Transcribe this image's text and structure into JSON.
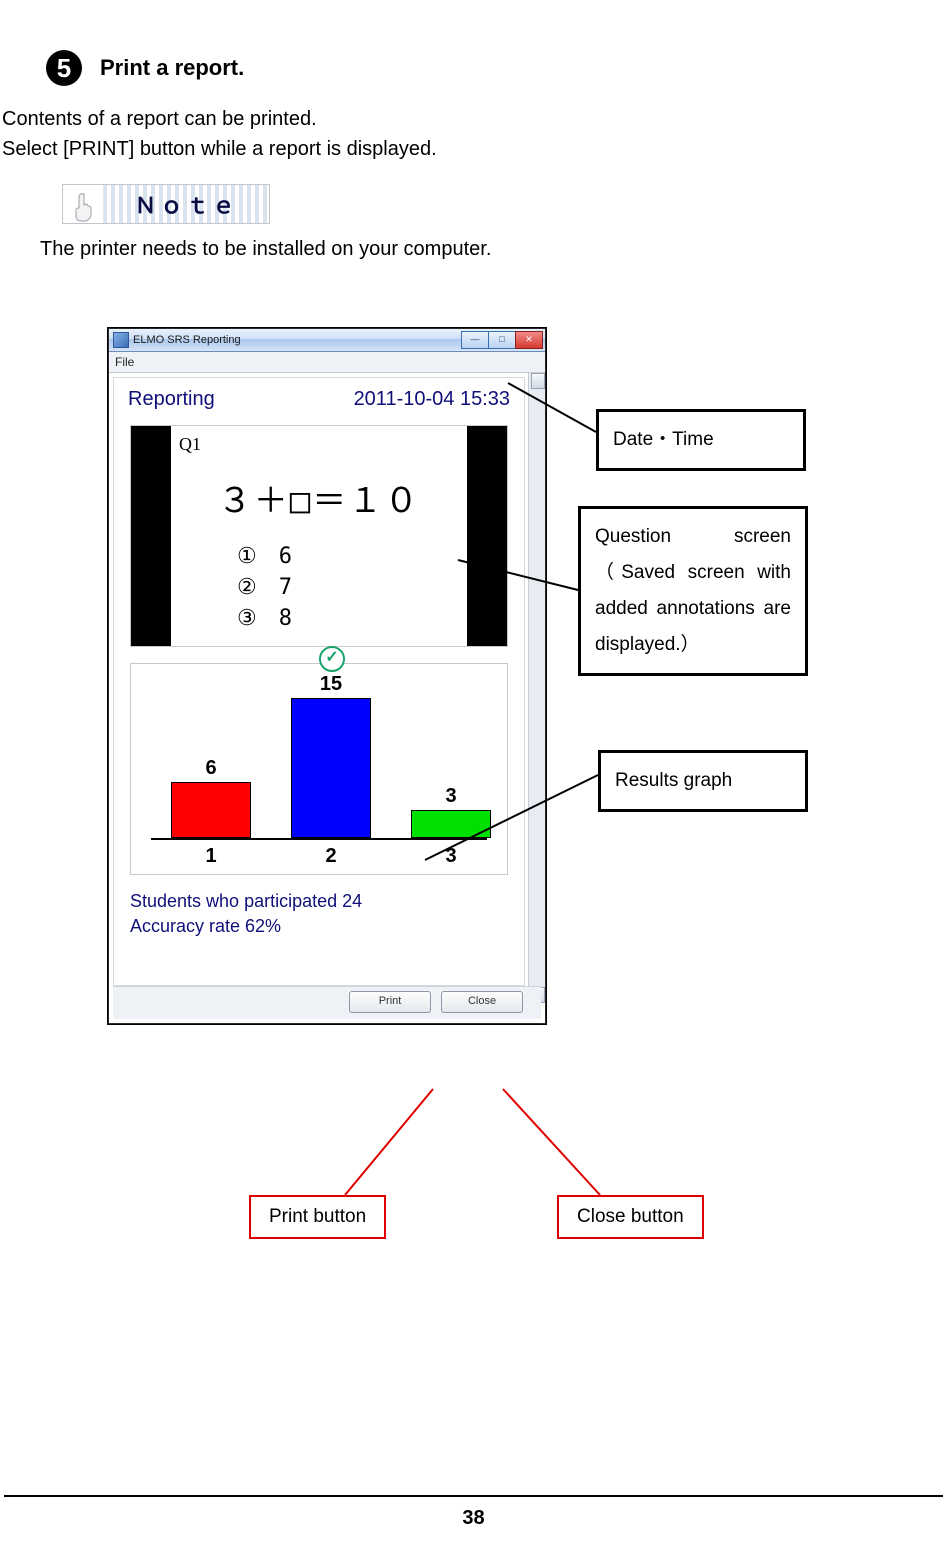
{
  "step": {
    "number": "5",
    "title": "Print a report."
  },
  "body": {
    "line1": "Contents of a report can be printed.",
    "line2": "Select [PRINT] button while a report is displayed."
  },
  "note": {
    "label": "Ｎｏｔｅ",
    "text": "The printer needs to be installed on your computer."
  },
  "window": {
    "title": "ELMO SRS Reporting",
    "menu_file": "File",
    "btn_min": "—",
    "btn_max": "□",
    "btn_close": "✕",
    "report_heading": "Reporting",
    "datetime": "2011-10-04  15:33",
    "question": {
      "label": "Q1",
      "formula": "３＋□＝１０",
      "opt1": "①　6",
      "opt2": "②　7",
      "opt3": "③　8"
    },
    "summary_line1": "Students who participated 24",
    "summary_line2": "Accuracy rate 62%",
    "print_btn": "Print",
    "close_btn": "Close"
  },
  "chart_data": {
    "type": "bar",
    "categories": [
      "1",
      "2",
      "3"
    ],
    "values": [
      6,
      15,
      3
    ],
    "correct_index": 1,
    "colors": [
      "#ff0000",
      "#0000ff",
      "#00e000"
    ],
    "title": "",
    "xlabel": "",
    "ylabel": "",
    "ylim": [
      0,
      15
    ]
  },
  "callouts": {
    "datetime": "Date・Time",
    "question": "Question screen （Saved screen with added annotations are displayed.）",
    "graph": "Results graph",
    "print": "Print button",
    "close": "Close button"
  },
  "page_number": "38"
}
